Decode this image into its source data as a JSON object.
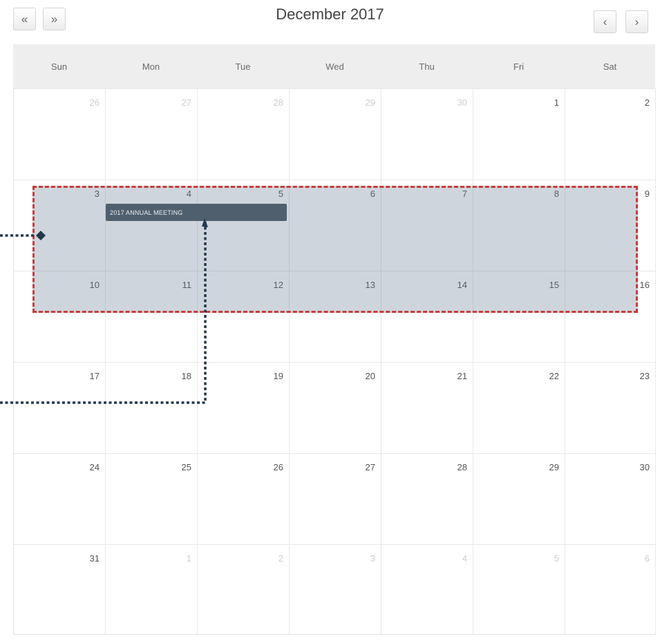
{
  "toolbar": {
    "prev_year_label": "«",
    "next_year_label": "»",
    "prev_month_label": "‹",
    "next_month_label": "›"
  },
  "calendar": {
    "title": "December 2017",
    "days_of_week": [
      "Sun",
      "Mon",
      "Tue",
      "Wed",
      "Thu",
      "Fri",
      "Sat"
    ],
    "weeks": [
      [
        {
          "day": "26",
          "muted": true
        },
        {
          "day": "27",
          "muted": true
        },
        {
          "day": "28",
          "muted": true
        },
        {
          "day": "29",
          "muted": true
        },
        {
          "day": "30",
          "muted": true
        },
        {
          "day": "1",
          "muted": false
        },
        {
          "day": "2",
          "muted": false
        }
      ],
      [
        {
          "day": "3",
          "muted": false
        },
        {
          "day": "4",
          "muted": false
        },
        {
          "day": "5",
          "muted": false
        },
        {
          "day": "6",
          "muted": false
        },
        {
          "day": "7",
          "muted": false
        },
        {
          "day": "8",
          "muted": false
        },
        {
          "day": "9",
          "muted": false
        }
      ],
      [
        {
          "day": "10",
          "muted": false
        },
        {
          "day": "11",
          "muted": false
        },
        {
          "day": "12",
          "muted": false
        },
        {
          "day": "13",
          "muted": false
        },
        {
          "day": "14",
          "muted": false
        },
        {
          "day": "15",
          "muted": false
        },
        {
          "day": "16",
          "muted": false
        }
      ],
      [
        {
          "day": "17",
          "muted": false
        },
        {
          "day": "18",
          "muted": false
        },
        {
          "day": "19",
          "muted": false
        },
        {
          "day": "20",
          "muted": false
        },
        {
          "day": "21",
          "muted": false
        },
        {
          "day": "22",
          "muted": false
        },
        {
          "day": "23",
          "muted": false
        }
      ],
      [
        {
          "day": "24",
          "muted": false
        },
        {
          "day": "25",
          "muted": false
        },
        {
          "day": "26",
          "muted": false
        },
        {
          "day": "27",
          "muted": false
        },
        {
          "day": "28",
          "muted": false
        },
        {
          "day": "29",
          "muted": false
        },
        {
          "day": "30",
          "muted": false
        }
      ],
      [
        {
          "day": "31",
          "muted": false
        },
        {
          "day": "1",
          "muted": true
        },
        {
          "day": "2",
          "muted": true
        },
        {
          "day": "3",
          "muted": true
        },
        {
          "day": "4",
          "muted": true
        },
        {
          "day": "5",
          "muted": true
        },
        {
          "day": "6",
          "muted": true
        }
      ]
    ],
    "event": {
      "title": "2017 ANNUAL MEETING",
      "start": "Mon 4",
      "end": "Tue 5",
      "color": "#4f5f6e"
    },
    "highlight_color": "#c83a3a",
    "callout_color": "#23374d"
  }
}
